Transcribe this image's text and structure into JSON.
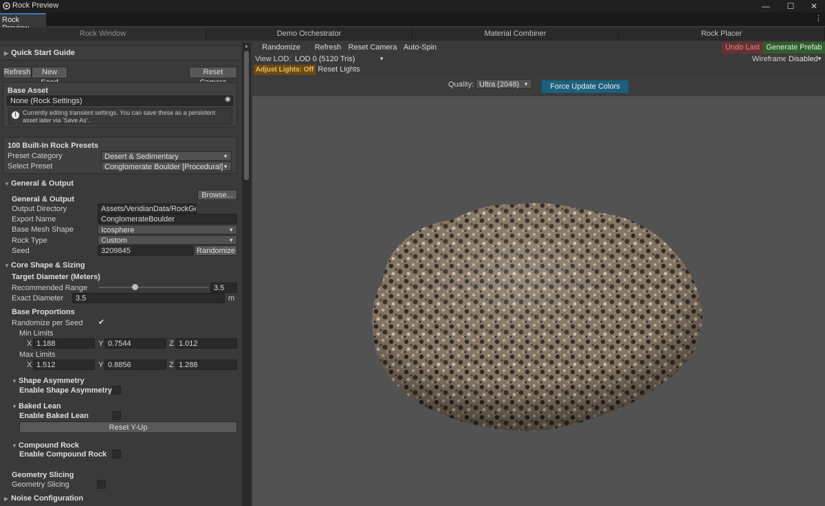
{
  "window": {
    "title": "Rock Preview",
    "tab": "Rock Preview",
    "tab_menu": "⋮",
    "min": "—",
    "max": "☐",
    "close": "✕"
  },
  "top_tabs": [
    "Rock Window",
    "Demo Orchestrator",
    "Material Combiner",
    "Rock Placer"
  ],
  "left": {
    "quick_start": "Quick Start Guide",
    "refresh": "Refresh",
    "new_seed": "New Seed",
    "reset_camera": "Reset Camera",
    "base_asset": {
      "title": "Base Asset",
      "value": "None (Rock Settings)",
      "info": "Currently editing transient settings. You can save these as a persistent asset later via 'Save As'."
    },
    "presets": {
      "title": "100 Built-In Rock Presets",
      "category_label": "Preset Category",
      "category_value": "Desert & Sedimentary",
      "preset_label": "Select Preset",
      "preset_value": "Conglomerate Boulder [Procedural]"
    },
    "general": {
      "section": "General & Output",
      "browse": "Browse...",
      "subheader": "General & Output",
      "output_dir_label": "Output Directory",
      "output_dir_value": "Assets/VeridianData/RockGener:",
      "export_name_label": "Export Name",
      "export_name_value": "ConglomerateBoulder",
      "mesh_label": "Base Mesh Shape",
      "mesh_value": "Icosphere",
      "rock_type_label": "Rock Type",
      "rock_type_value": "Custom",
      "seed_label": "Seed",
      "seed_value": "3209845",
      "randomize": "Randomize"
    },
    "core": {
      "section": "Core Shape & Sizing",
      "target_header": "Target Diameter (Meters)",
      "range_label": "Recommended Range",
      "range_value": "3.5",
      "range_fraction": 0.33,
      "exact_label": "Exact Diameter",
      "exact_value": "3.5",
      "exact_unit": "m",
      "base_prop": "Base Proportions",
      "rand_label": "Randomize per Seed",
      "min_limits": "Min Limits",
      "min": {
        "x": "1.188",
        "y": "0.7544",
        "z": "1.012"
      },
      "max_limits": "Max Limits",
      "max": {
        "x": "1.512",
        "y": "0.8856",
        "z": "1.288"
      },
      "x": "X",
      "y": "Y",
      "z": "Z",
      "shape_asym": "Shape Asymmetry",
      "enable_shape_asym": "Enable Shape Asymmetry",
      "baked_lean": "Baked Lean",
      "enable_baked_lean": "Enable Baked Lean",
      "reset_y_up": "Reset Y-Up",
      "compound": "Compound Rock",
      "enable_compound": "Enable Compound Rock",
      "slicing_header": "Geometry Slicing",
      "slicing_label": "Geometry Slicing"
    },
    "noise": "Noise Configuration"
  },
  "right": {
    "randomize_seed": "Randomize Seed",
    "refresh": "Refresh",
    "reset_camera": "Reset Camera",
    "auto_spin": "Auto-Spin",
    "undo_last": "Undo Last",
    "generate_prefab": "Generate Prefab",
    "view_lod_label": "View LOD:",
    "view_lod_value": "LOD 0 (5120 Tris)",
    "wireframe_label": "Wireframe:",
    "wireframe_value": "Disabled",
    "adjust_lights": "Adjust Lights: Off",
    "reset_lights": "Reset Lights",
    "quality_label": "Quality:",
    "quality_value": "Ultra (2048)",
    "force_update": "Force Update Colors"
  },
  "colors": {
    "accent_blue": "#1e5f7a",
    "generate_green": "#2f5f2f",
    "undo_red": "#6a3030",
    "adjust_orange": "#6b4a12"
  }
}
